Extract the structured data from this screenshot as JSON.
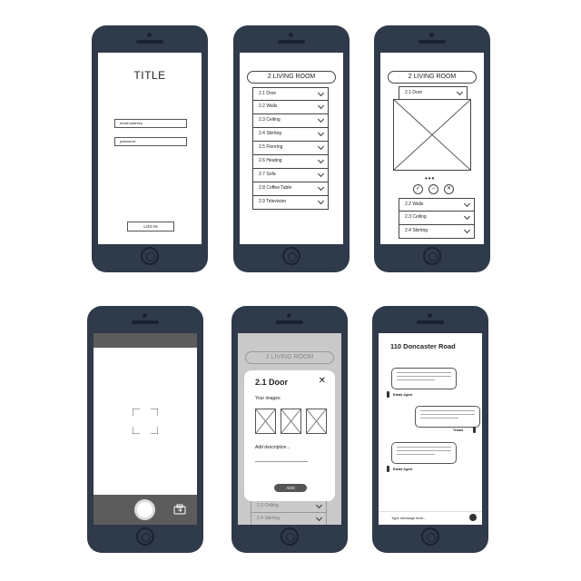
{
  "screen1": {
    "title": "TITLE",
    "email_placeholder": "email address",
    "password_placeholder": "password",
    "login_label": "LOG IN"
  },
  "screen2": {
    "header": "2 LIVING ROOM",
    "items": [
      "2.1 Door",
      "2.2 Walls",
      "2.3 Ceiling",
      "2.4 Skirting",
      "2.5 Flooring",
      "2.6 Heating",
      "2.7 Sofa",
      "2.8 Coffee Table",
      "2.9 Television"
    ]
  },
  "screen3": {
    "header": "2 LIVING ROOM",
    "top_item": "2.1 Door",
    "dots": "•••",
    "icons": [
      "check-icon",
      "minus-icon",
      "cross-icon"
    ],
    "items": [
      "2.2 Walls",
      "2.3 Ceiling",
      "2.4 Skirting"
    ]
  },
  "screen4": {
    "icons": [
      "focus-frame-icon",
      "shutter-button-icon",
      "switch-camera-icon"
    ]
  },
  "screen5": {
    "header": "2 LIVING ROOM",
    "modal_title": "2.1 Door",
    "close_glyph": "✕",
    "images_label": "Your images",
    "desc_label": "Add description...",
    "add_label": "ADD",
    "below_items": [
      "2.3 Ceiling",
      "2.4 Skirting"
    ]
  },
  "screen6": {
    "title": "110 Doncaster Road",
    "agent_label": "Estate Agent",
    "tenant_label": "Tenant",
    "type_placeholder": "Type message here..."
  }
}
